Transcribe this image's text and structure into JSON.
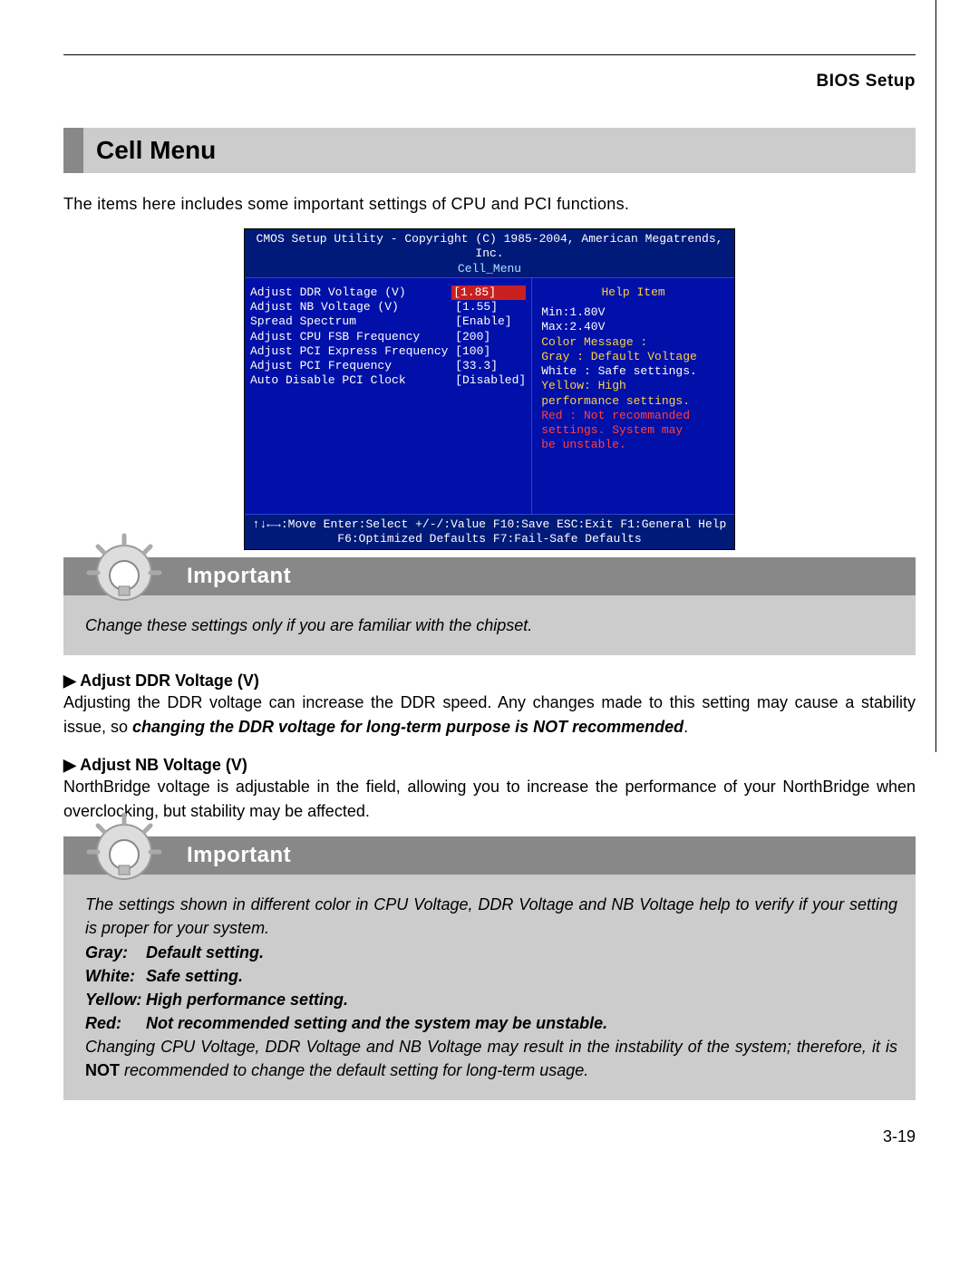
{
  "header": {
    "title": "BIOS Setup"
  },
  "section": {
    "title": "Cell Menu"
  },
  "intro": "The items here includes some important settings of CPU and PCI functions.",
  "bios": {
    "top1": "CMOS Setup Utility - Copyright (C) 1985-2004, American Megatrends, Inc.",
    "top2": "Cell_Menu",
    "rows": [
      {
        "label": "Adjust DDR Voltage (V)",
        "value": "[1.85]",
        "red": true
      },
      {
        "label": "Adjust NB Voltage (V)",
        "value": "[1.55]"
      },
      {
        "label": "Spread Spectrum",
        "value": "[Enable]"
      },
      {
        "label": "Adjust CPU FSB Frequency",
        "value": "[200]"
      },
      {
        "label": "Adjust PCI Express Frequency",
        "value": "[100]"
      },
      {
        "label": "Adjust PCI Frequency",
        "value": "[33.3]"
      },
      {
        "label": "Auto Disable PCI Clock",
        "value": "[Disabled]"
      }
    ],
    "help": {
      "title": "Help Item",
      "min": "Min:1.80V",
      "max": "Max:2.40V",
      "cmsg": "Color Message :",
      "gray": "Gray : Default Voltage",
      "white": "White : Safe settings.",
      "yellow1": "Yellow: High",
      "yellow2": "performance settings.",
      "red1": "Red : Not recommanded",
      "red2": "settings. System may",
      "red3": "be unstable."
    },
    "footer1": "↑↓←→:Move  Enter:Select  +/-/:Value  F10:Save  ESC:Exit  F1:General Help",
    "footer2": "F6:Optimized Defaults   F7:Fail-Safe Defaults"
  },
  "important1": {
    "label": "Important",
    "body": "Change these settings only if you are familiar with the chipset."
  },
  "setting1": {
    "title": "▶ Adjust DDR Voltage (V)",
    "body_pre": "Adjusting the DDR voltage can increase the DDR speed.  Any changes made to this setting may cause a stability issue, so ",
    "body_em": "changing the DDR voltage for long-term purpose is NOT recommended",
    "body_post": "."
  },
  "setting2": {
    "title": "▶ Adjust NB Voltage (V)",
    "body": "NorthBridge voltage is adjustable in the field, allowing you to increase the performance of your NorthBridge when overclocking, but stability may be affected."
  },
  "important2": {
    "label": "Important",
    "p1": "The settings shown in different color in CPU Voltage, DDR Voltage and NB Voltage help to verify if your setting is proper for your system.",
    "gray_l": "Gray:",
    "gray_v": "Default setting.",
    "white_l": "White:",
    "white_v": "Safe setting.",
    "yellow_l": "Yellow:",
    "yellow_v": "High performance setting.",
    "red_l": "Red:",
    "red_v": "Not recommended setting and the system may be unstable.",
    "p2_pre": "Changing CPU Voltage, DDR Voltage and NB Voltage may result in the instability of the system; therefore, it is ",
    "p2_not": "NOT",
    "p2_post": " recommended to change the default setting for long-term usage."
  },
  "pagenum": "3-19"
}
